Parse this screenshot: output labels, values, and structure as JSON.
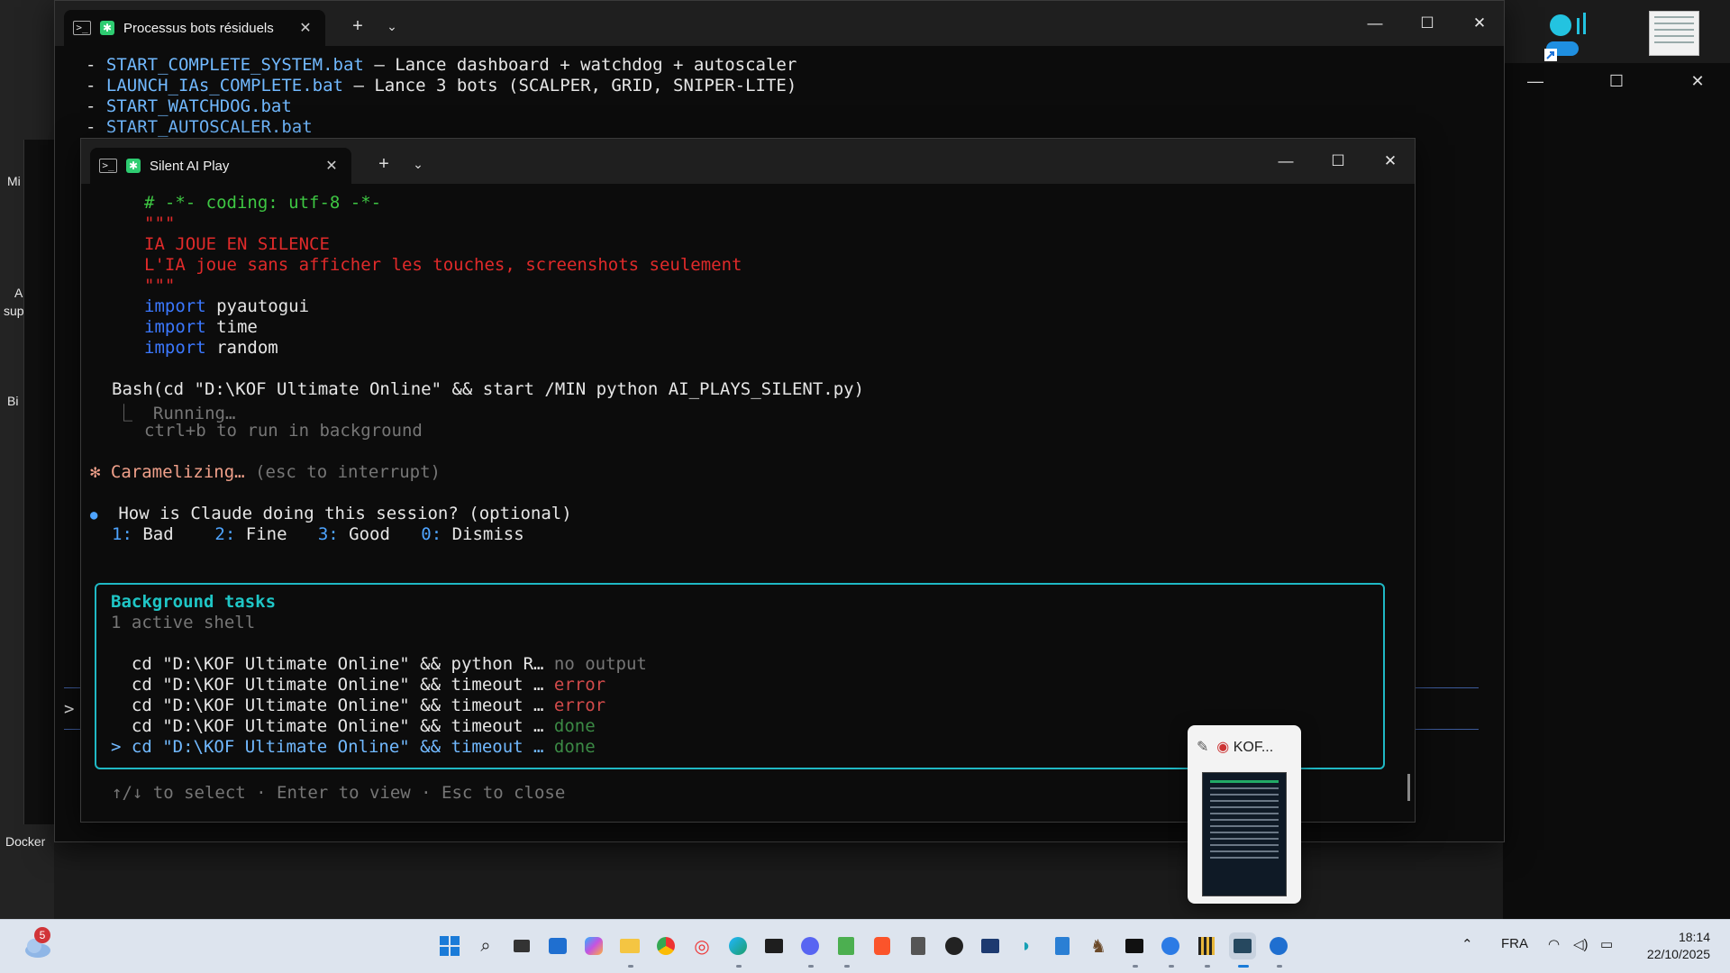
{
  "outer_window": {
    "tab_title": "Processus bots résiduels",
    "lines": [
      {
        "dash": "- ",
        "file": "START_COMPLETE_SYSTEM.bat",
        "desc": " – Lance dashboard + watchdog + autoscaler"
      },
      {
        "dash": "- ",
        "file": "LAUNCH_IAs_COMPLETE.bat",
        "desc": " – Lance 3 bots (SCALPER, GRID, SNIPER-LITE)"
      },
      {
        "dash": "- ",
        "file": "START_WATCHDOG.bat",
        "desc": ""
      },
      {
        "dash": "- ",
        "file": "START_AUTOSCALER.bat",
        "desc": ""
      }
    ]
  },
  "inner_window": {
    "tab_title": "Silent AI Play",
    "code": {
      "coding": "# -*- coding: utf-8 -*-",
      "docstring_open": "\"\"\"",
      "doc_line1": "IA JOUE EN SILENCE",
      "doc_line2": "L'IA joue sans afficher les touches, screenshots seulement",
      "docstring_close": "\"\"\"",
      "imports": [
        {
          "kw": "import",
          "mod": " pyautogui"
        },
        {
          "kw": "import",
          "mod": " time"
        },
        {
          "kw": "import",
          "mod": " random"
        }
      ]
    },
    "bash_cmd": "Bash(cd \"D:\\KOF Ultimate Online\" && start /MIN python AI_PLAYS_SILENT.py)",
    "running": "⎿  Running…",
    "bg_hint": "ctrl+b to run in background",
    "status_star": "✻",
    "status_word": "Caramelizing…",
    "status_hint": " (esc to interrupt)",
    "feedback": {
      "bullet": "●",
      "question": "How is Claude doing this session? (optional)",
      "options": [
        {
          "key": "1:",
          "label": " Bad"
        },
        {
          "key": "2:",
          "label": " Fine"
        },
        {
          "key": "3:",
          "label": " Good"
        },
        {
          "key": "0:",
          "label": " Dismiss"
        }
      ]
    },
    "panel": {
      "title": "Background tasks",
      "subtitle": "1 active shell",
      "tasks": [
        {
          "prefix": "  ",
          "cmd": "cd \"D:\\KOF Ultimate Online\" && python R… ",
          "status": "no output",
          "kind": "gray"
        },
        {
          "prefix": "  ",
          "cmd": "cd \"D:\\KOF Ultimate Online\" && timeout … ",
          "status": "error",
          "kind": "err"
        },
        {
          "prefix": "  ",
          "cmd": "cd \"D:\\KOF Ultimate Online\" && timeout … ",
          "status": "error",
          "kind": "err"
        },
        {
          "prefix": "  ",
          "cmd": "cd \"D:\\KOF Ultimate Online\" && timeout … ",
          "status": "done",
          "kind": "done"
        },
        {
          "prefix": "> ",
          "cmd": "cd \"D:\\KOF Ultimate Online\" && timeout … ",
          "status": "done",
          "kind": "done"
        }
      ]
    },
    "footer": "↑/↓ to select · Enter to view · Esc to close"
  },
  "desktop": {
    "labels": [
      "Mi",
      "A",
      "sup",
      "Bi",
      "Docker"
    ]
  },
  "preview": {
    "title": "KOF..."
  },
  "taskbar": {
    "weather_badge": "5",
    "lang": "FRA",
    "time": "18:14",
    "date": "22/10/2025"
  },
  "icons": [
    "search-icon",
    "task-view-icon",
    "store-icon",
    "copilot-icon",
    "folder-icon",
    "chrome-icon",
    "opera-icon",
    "edge-icon",
    "terminal-icon",
    "discord-icon",
    "notepad-icon",
    "brave-icon",
    "calculator-icon",
    "obs-icon",
    "powershell-icon",
    "app-icon",
    "notes-icon",
    "game-icon",
    "cmd-icon",
    "bluestacks-icon",
    "kof-icon",
    "kof-game-icon",
    "mx-icon"
  ]
}
